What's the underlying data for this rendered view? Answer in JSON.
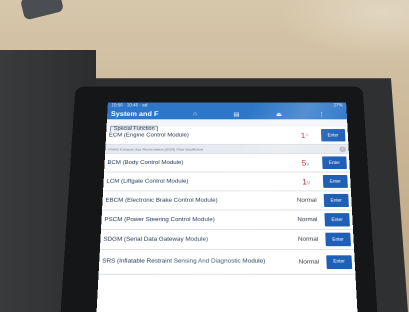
{
  "status_bar": {
    "time": "10:56",
    "left_text": "10:56 · 10:46 · ad",
    "right_text": "27%"
  },
  "app": {
    "title": "System and F",
    "nav_icons": [
      "home-icon",
      "document-icon",
      "upload-icon",
      "more-icon"
    ],
    "section_tab": "Special Function"
  },
  "dtc_row": {
    "text": "P0401 Exhaust Gas Recirculation (EGR) Flow Insufficient"
  },
  "modules": [
    {
      "name": "ECM (Engine Control Module)",
      "status": "1",
      "indicator": "^",
      "button": "Enter"
    },
    {
      "name": "BCM (Body Control Module)",
      "status": "5",
      "indicator": "v",
      "button": "Enter"
    },
    {
      "name": "LCM (Liftgate Control Module)",
      "status": "1",
      "indicator": "v",
      "button": "Enter"
    },
    {
      "name": "EBCM (Electronic Brake Control Module)",
      "status": "Normal",
      "indicator": "",
      "button": "Enter"
    },
    {
      "name": "PSCM (Power Steering Control Module)",
      "status": "Normal",
      "indicator": "",
      "button": "Enter"
    },
    {
      "name": "SDGM (Serial Data Gateway Module)",
      "status": "Normal",
      "indicator": "",
      "button": "Enter"
    },
    {
      "name": "SRS (Inflatable Restraint Sensing And Diagnostic Module)",
      "status": "Normal",
      "indicator": "",
      "button": "Enter"
    }
  ],
  "colors": {
    "header": "#2e77c8",
    "button": "#1f5fb6",
    "fault_count": "#b0262e"
  }
}
